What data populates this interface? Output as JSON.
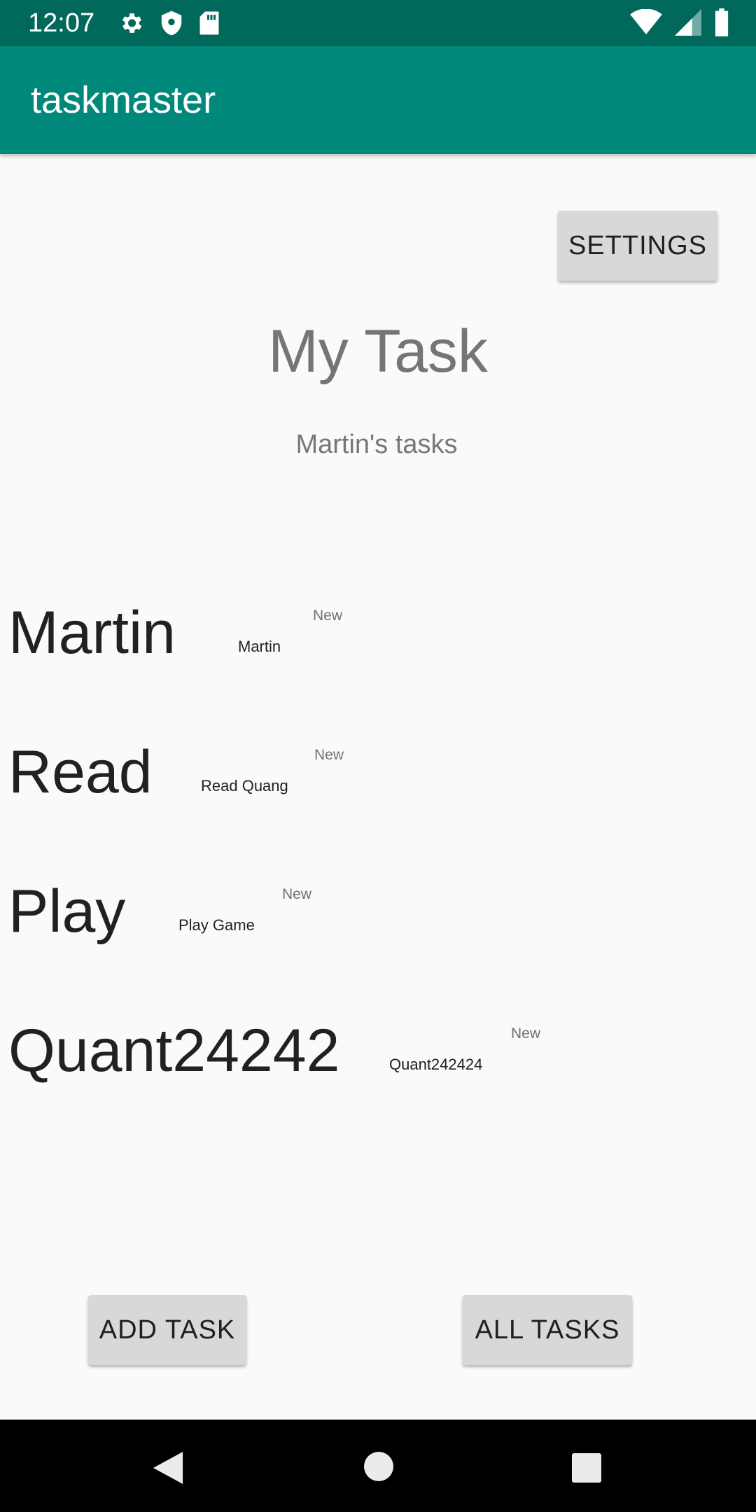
{
  "status_bar": {
    "time": "12:07",
    "left_icons": [
      "gear-icon",
      "shield-icon",
      "sd-card-icon"
    ],
    "right_icons": [
      "wifi-icon",
      "signal-icon",
      "battery-icon"
    ]
  },
  "app_bar": {
    "title": "taskmaster"
  },
  "settings_button": {
    "label": "SETTINGS"
  },
  "heading": {
    "title": "My Task",
    "subtitle": "Martin's tasks"
  },
  "tasks": [
    {
      "title": "Martin",
      "body": "Martin",
      "state": "New"
    },
    {
      "title": "Read",
      "body": "Read Quang",
      "state": "New"
    },
    {
      "title": "Play",
      "body": "Play Game",
      "state": "New"
    },
    {
      "title": "Quant24242",
      "body": "Quant242424",
      "state": "New"
    }
  ],
  "bottom_buttons": {
    "add_label": "ADD TASK",
    "all_label": "ALL TASKS"
  },
  "nav_bar": {
    "icons": [
      "back-icon",
      "home-icon",
      "recents-icon"
    ]
  },
  "colors": {
    "status_bar": "#00695c",
    "app_bar": "#00897b",
    "button": "#d8d8d8",
    "background": "#fafafa"
  }
}
